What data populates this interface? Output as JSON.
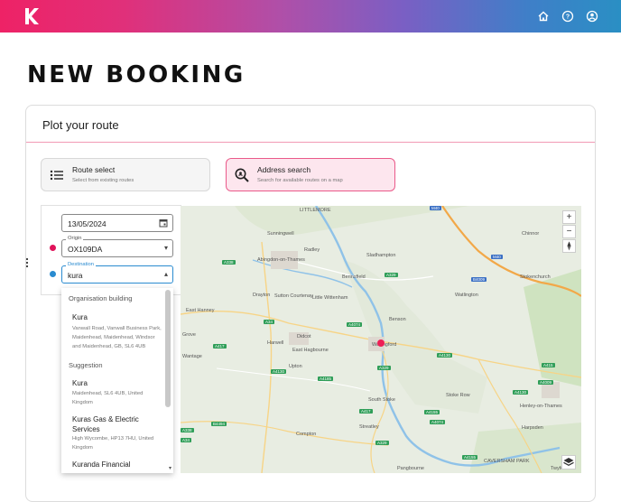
{
  "app": {
    "logo": "K"
  },
  "topbar": {
    "icons": [
      "home-icon",
      "help-icon",
      "account-icon"
    ]
  },
  "page": {
    "title": "NEW BOOKING"
  },
  "card": {
    "title": "Plot your route"
  },
  "options": [
    {
      "title": "Route select",
      "subtitle": "Select from existing routes",
      "icon": "list-icon",
      "active": false
    },
    {
      "title": "Address search",
      "subtitle": "Search for available routes on a map",
      "icon": "map-search-icon",
      "active": true
    }
  ],
  "form": {
    "date": "13/05/2024",
    "origin_label": "Origin",
    "origin_value": "OX109DA",
    "destination_label": "Destination",
    "destination_value": "kura"
  },
  "dropdown": {
    "groups": [
      {
        "heading": "Organisation building",
        "items": [
          {
            "name": "Kura",
            "address": "Vanwall Road, Vanwall Business Park, Maidenhead, Maidenhead, Windsor and Maidenhead, GB, SL6 4UB"
          }
        ]
      },
      {
        "heading": "Suggestion",
        "items": [
          {
            "name": "Kura",
            "address": "Maidenhead, SL6 4UB, United Kingdom"
          },
          {
            "name": "Kuras Gas & Electric Services",
            "address": "High Wycombe, HP13 7HU, United Kingdom"
          },
          {
            "name": "Kuranda Financial",
            "address": ""
          }
        ]
      }
    ]
  },
  "map": {
    "places": [
      "LITTLEMORE",
      "Sunningwell",
      "Radley",
      "Abingdon-on-Thames",
      "Sladhampton",
      "Chinnor",
      "Berinsfield",
      "Stokenchurch",
      "Drayton",
      "Sutton Courtenay",
      "Little Wittenham",
      "Watlington",
      "East Hanney",
      "Benson",
      "Didcot",
      "East Hagbourne",
      "Harwell",
      "Wallingford",
      "Upton",
      "Stoke Row",
      "South Stoke",
      "Henley-on-Thames",
      "Streatley",
      "Compton",
      "Harpsden",
      "Pangbourne",
      "CAVERSHAM PARK",
      "Twyford",
      "Grove",
      "Wantage"
    ],
    "roads": [
      "M40",
      "A329",
      "M40",
      "B4009",
      "A4074",
      "A34",
      "A417",
      "A4130",
      "A4185",
      "A329",
      "A4130",
      "A4130",
      "A4155",
      "A417",
      "A4074",
      "A4009",
      "B4494",
      "A338",
      "A34",
      "A329",
      "A4155",
      "A415",
      "A338"
    ],
    "controls": [
      "+",
      "−"
    ],
    "colors": {
      "pin": "#ee1f55",
      "water": "#8fc2e8",
      "motorway": "#f2a848",
      "green": "#cfe3c0"
    }
  },
  "colors": {
    "accent": "#ea5a8a",
    "focus": "#2a8bd0",
    "origin_dot": "#e0135a",
    "destination_dot": "#2a8bd0"
  }
}
